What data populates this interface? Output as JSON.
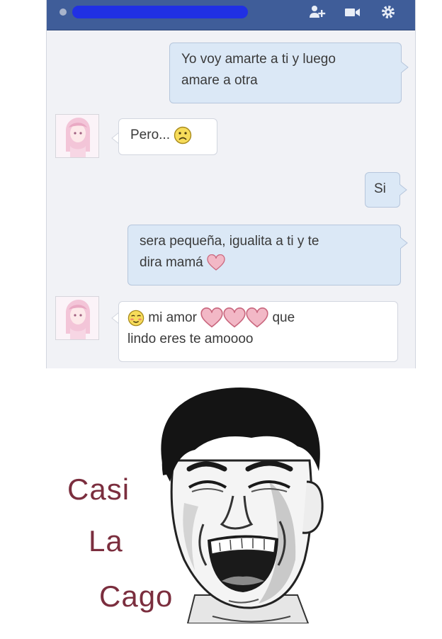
{
  "chat": {
    "messages": [
      {
        "side": "out",
        "text_line1": "Yo voy amarte a ti y luego",
        "text_line2": "amare a otra"
      },
      {
        "side": "in",
        "text": "Pero..."
      },
      {
        "side": "out",
        "text": "Si"
      },
      {
        "side": "out",
        "text_line1": "sera pequeña, igualita a ti y te",
        "text_line2": "dira mamá"
      },
      {
        "side": "in",
        "text_line1_a": "mi amor",
        "text_line1_b": "que",
        "text_line2": "lindo eres te amoooo"
      }
    ]
  },
  "icons": {
    "titlebar": [
      "add-friend-icon",
      "video-call-icon",
      "gear-icon"
    ],
    "emoji": [
      "frown-face-icon",
      "heart-icon",
      "blush-face-icon"
    ]
  },
  "meme": {
    "caption_line1": "Casi",
    "caption_line2": "La",
    "caption_line3": "Cago"
  },
  "colors": {
    "titlebar": "#3f5d99",
    "outgoing_bubble": "#dbe8f6",
    "incoming_bubble": "#ffffff",
    "heart": "#f2b8c6",
    "caption": "#7b2e3e"
  }
}
